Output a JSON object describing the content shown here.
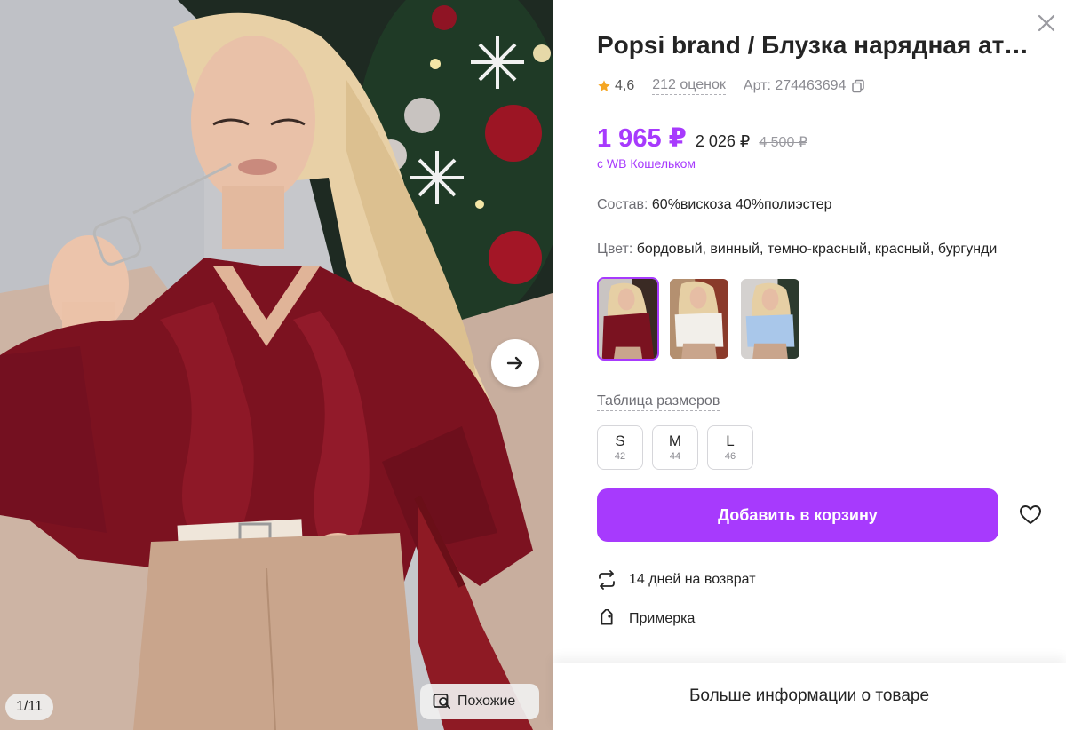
{
  "gallery": {
    "counter": "1/11",
    "similar_label": "Похожие"
  },
  "product": {
    "title": "Popsi brand / Блузка нарядная атласная с воланами",
    "rating": "4,6",
    "reviews": "212 оценок",
    "article": "Арт: 274463694",
    "price_main": "1 965 ₽",
    "price_secondary": "2 026 ₽",
    "price_old": "4 500 ₽",
    "wallet_note": "с WB Кошельком",
    "composition_label": "Состав:",
    "composition_value": "60%вискоза 40%полиэстер",
    "color_label": "Цвет:",
    "color_value": "бордовый, винный, темно-красный, красный, бургунди",
    "swatches": [
      {
        "name": "burgundy",
        "top_color": "#7a1220"
      },
      {
        "name": "white",
        "top_color": "#f2efea"
      },
      {
        "name": "light-blue",
        "top_color": "#a9c7ea"
      }
    ],
    "size_table_label": "Таблица размеров",
    "sizes": [
      {
        "label": "S",
        "num": "42"
      },
      {
        "label": "M",
        "num": "44"
      },
      {
        "label": "L",
        "num": "46"
      }
    ],
    "add_to_cart": "Добавить в корзину",
    "return_policy": "14 дней на возврат",
    "fitting": "Примерка",
    "more_info": "Больше информации о товаре"
  },
  "colors": {
    "accent": "#a73afd",
    "star": "#f5a623"
  },
  "icons": {
    "close": "close-icon",
    "next": "arrow-right-icon",
    "similar": "image-search-icon",
    "star": "star-icon",
    "copy": "copy-icon",
    "favorite": "heart-icon",
    "return": "return-arrows-icon",
    "fitting": "tag-icon"
  }
}
